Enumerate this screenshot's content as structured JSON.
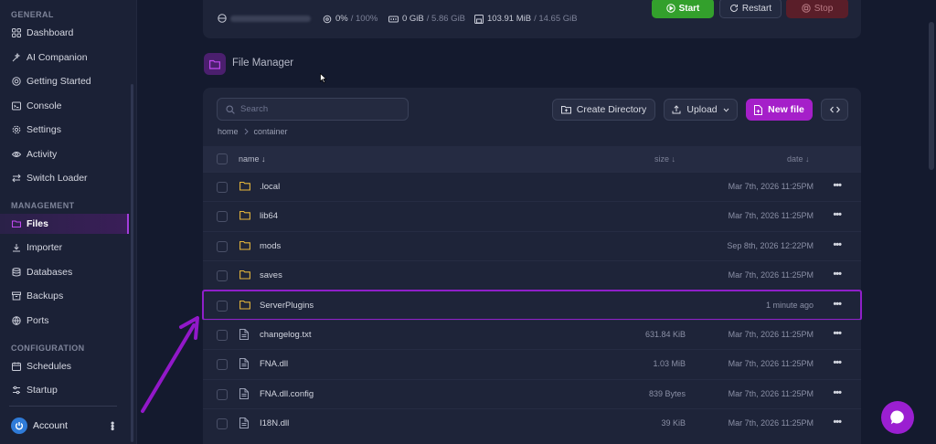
{
  "sidebar": {
    "sections": [
      {
        "title": "GENERAL",
        "items": [
          {
            "label": "Dashboard",
            "icon": "dashboard-icon"
          },
          {
            "label": "AI Companion",
            "icon": "sparkles-icon"
          },
          {
            "label": "Getting Started",
            "icon": "lifebuoy-icon"
          },
          {
            "label": "Console",
            "icon": "terminal-icon"
          },
          {
            "label": "Settings",
            "icon": "gear-icon"
          },
          {
            "label": "Activity",
            "icon": "eye-icon"
          },
          {
            "label": "Switch Loader",
            "icon": "swap-icon"
          }
        ]
      },
      {
        "title": "MANAGEMENT",
        "items": [
          {
            "label": "Files",
            "icon": "folder-icon",
            "active": true
          },
          {
            "label": "Importer",
            "icon": "download-icon"
          },
          {
            "label": "Databases",
            "icon": "database-icon"
          },
          {
            "label": "Backups",
            "icon": "archive-icon"
          },
          {
            "label": "Ports",
            "icon": "globe-icon"
          }
        ]
      },
      {
        "title": "CONFIGURATION",
        "items": [
          {
            "label": "Schedules",
            "icon": "calendar-icon"
          },
          {
            "label": "Startup",
            "icon": "sliders-icon"
          }
        ]
      }
    ],
    "account": {
      "label": "Account"
    }
  },
  "status": {
    "cpu_value": "0%",
    "cpu_limit": "/ 100%",
    "memory_value": "0 GiB",
    "memory_limit": "/ 5.86 GiB",
    "disk_value": "103.91 MiB",
    "disk_limit": "/ 14.65 GiB"
  },
  "power": {
    "start": "Start",
    "restart": "Restart",
    "stop": "Stop"
  },
  "file_manager": {
    "title": "File Manager",
    "search_placeholder": "Search",
    "create_directory": "Create Directory",
    "upload": "Upload",
    "new_file": "New file",
    "breadcrumb": [
      "home",
      "container"
    ],
    "columns": {
      "name": "name ↓",
      "size": "size ↓",
      "date": "date ↓"
    },
    "files": [
      {
        "name": ".local",
        "type": "folder",
        "size": "",
        "date": "Mar 7th, 2026 11:25PM"
      },
      {
        "name": "lib64",
        "type": "folder",
        "size": "",
        "date": "Mar 7th, 2026 11:25PM"
      },
      {
        "name": "mods",
        "type": "folder",
        "size": "",
        "date": "Sep 8th, 2026 12:22PM"
      },
      {
        "name": "saves",
        "type": "folder",
        "size": "",
        "date": "Mar 7th, 2026 11:25PM"
      },
      {
        "name": "ServerPlugins",
        "type": "folder",
        "size": "",
        "date": "1 minute ago",
        "highlighted": true
      },
      {
        "name": "changelog.txt",
        "type": "file",
        "size": "631.84 KiB",
        "date": "Mar 7th, 2026 11:25PM"
      },
      {
        "name": "FNA.dll",
        "type": "file",
        "size": "1.03 MiB",
        "date": "Mar 7th, 2026 11:25PM"
      },
      {
        "name": "FNA.dll.config",
        "type": "file",
        "size": "839 Bytes",
        "date": "Mar 7th, 2026 11:25PM"
      },
      {
        "name": "I18N.dll",
        "type": "file",
        "size": "39 KiB",
        "date": "Mar 7th, 2026 11:25PM"
      }
    ]
  },
  "colors": {
    "accent": "#a51fc9",
    "start": "#33a02c",
    "folder": "#e5b63a",
    "highlight": "#8f1fc9"
  }
}
